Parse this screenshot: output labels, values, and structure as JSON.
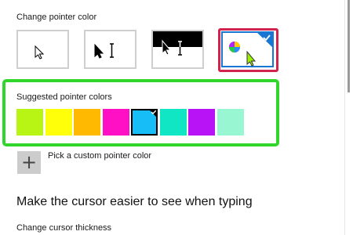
{
  "pointer_color": {
    "label": "Change pointer color",
    "options": [
      {
        "name": "white-pointer"
      },
      {
        "name": "black-pointer"
      },
      {
        "name": "inverted-pointer"
      },
      {
        "name": "custom-color-pointer",
        "selected": true
      }
    ]
  },
  "suggested": {
    "label": "Suggested pointer colors",
    "colors": [
      "#b8f414",
      "#ffff0a",
      "#ffb900",
      "#ff10c4",
      "#16bdf6",
      "#10e6c4",
      "#b812f7",
      "#98f7d2"
    ],
    "selected_index": 4
  },
  "custom": {
    "label": "Pick a custom pointer color",
    "icon": "plus-icon"
  },
  "typing": {
    "heading": "Make the cursor easier to see when typing",
    "thickness_label": "Change cursor thickness"
  },
  "colors": {
    "highlight_red": "#d0234d",
    "highlight_green": "#32d52c",
    "accent_blue": "#1976d2"
  }
}
